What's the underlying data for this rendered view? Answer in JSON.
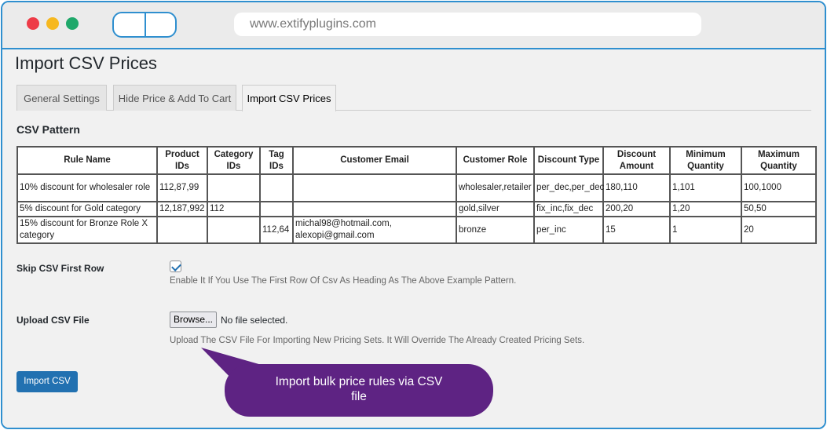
{
  "browser": {
    "url": "www.extifyplugins.com"
  },
  "page": {
    "title": "Import CSV Prices"
  },
  "tabs": [
    {
      "label": "General Settings",
      "active": false
    },
    {
      "label": "Hide Price & Add To Cart",
      "active": false
    },
    {
      "label": "Import CSV Prices",
      "active": true
    }
  ],
  "csv_pattern": {
    "title": "CSV Pattern",
    "headers": [
      "Rule Name",
      "Product IDs",
      "Category IDs",
      "Tag IDs",
      "Customer Email",
      "Customer Role",
      "Discount Type",
      "Discount Amount",
      "Minimum Quantity",
      "Maximum Quantity"
    ],
    "rows": [
      [
        "10% discount for wholesaler role",
        "112,87,99",
        "",
        "",
        "",
        "wholesaler,retailer",
        "per_dec,per_dec",
        "180,110",
        "1,101",
        "100,1000"
      ],
      [
        "5% discount for Gold category",
        "12,187,992",
        "112",
        "",
        "",
        "gold,silver",
        "fix_inc,fix_dec",
        "200,20",
        "1,20",
        "50,50"
      ],
      [
        "15% discount for Bronze Role X category",
        "",
        "",
        "112,64",
        "michal98@hotmail.com, alexopi@gmail.com",
        "bronze",
        "per_inc",
        "15",
        "1",
        "20"
      ]
    ]
  },
  "skip_first_row": {
    "label": "Skip CSV First Row",
    "checked": true,
    "help": "Enable It If You Use The First Row Of Csv As Heading As The Above Example Pattern."
  },
  "upload": {
    "label": "Upload CSV File",
    "browse_label": "Browse...",
    "status": "No file selected.",
    "help": "Upload The CSV File For Importing New Pricing Sets. It Will Override The Already Created Pricing Sets."
  },
  "import_button": {
    "label": "Import CSV"
  },
  "callout": {
    "line1": "Import bulk price rules via CSV",
    "line2": "file",
    "color": "#5e2383"
  },
  "colors": {
    "frame": "#2f8fcf",
    "primary_button": "#2271b1"
  }
}
